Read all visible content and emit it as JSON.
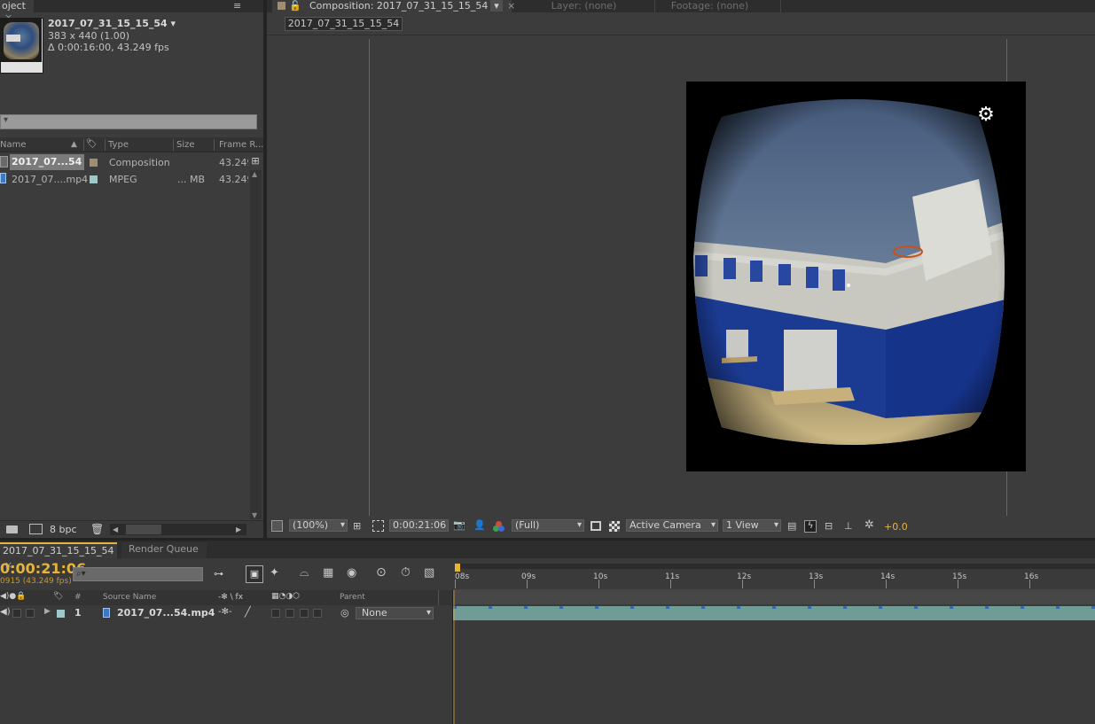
{
  "project_panel": {
    "tab_label": "oject",
    "close_glyph": "×",
    "menu_glyph": "≡",
    "item_name": "2017_07_31_15_15_54",
    "item_name_arrow": "▾",
    "item_dimensions": "383 x 440 (1.00)",
    "item_duration": "Δ 0:00:16:00, 43.249 fps",
    "search_glyph": "▾",
    "columns": {
      "name": "Name",
      "sort": "▲",
      "type": "Type",
      "size": "Size",
      "frame_rate": "Frame R..."
    },
    "rows": [
      {
        "name": "2017_07...54",
        "type": "Composition",
        "size": "",
        "frame_rate": "43.249",
        "label_color": "#a28d6f"
      },
      {
        "name": "2017_07....mp4",
        "type": "MPEG",
        "size": "... MB",
        "frame_rate": "43.249",
        "label_color": "#9fc8c8"
      }
    ],
    "bpc": "8 bpc",
    "scroll_up": "▲",
    "scroll_down": "▼",
    "scroll_left": "◀",
    "scroll_right": "▶"
  },
  "comp_panel": {
    "tab_label": "Composition: 2017_07_31_15_15_54",
    "tab_menu": "▾",
    "tab_close": "×",
    "layer_tab": "Layer: (none)",
    "footage_tab": "Footage: (none)",
    "comp_chip": "2017_07_31_15_15_54",
    "toolbar": {
      "zoom": "(100%)",
      "timecode": "0:00:21:06",
      "resolution": "(Full)",
      "camera": "Active Camera",
      "views": "1 View",
      "exposure": "+0.0"
    }
  },
  "timeline": {
    "tab_label": "2017_07_31_15_15_54",
    "tab_close": "×",
    "render_queue_tab": "Render Queue",
    "timecode": "0:00:21:06",
    "frame_info": "0915 (43.249 fps)",
    "search_glyph": "⌕▾",
    "columns": {
      "hash": "#",
      "source_name": "Source Name",
      "switches": "-✻ \\ fx",
      "parent": "Parent"
    },
    "layer": {
      "number": "1",
      "name": "2017_07...54.mp4",
      "parent": "None"
    },
    "ruler_labels": [
      "08s",
      "09s",
      "10s",
      "11s",
      "12s",
      "13s",
      "14s",
      "15s",
      "16s"
    ]
  },
  "colors": {
    "accent_yellow": "#e7b43a",
    "track_teal": "#6f9c94",
    "panel_bg": "#3c3c3c",
    "tab_bg": "#2d2d2d"
  }
}
